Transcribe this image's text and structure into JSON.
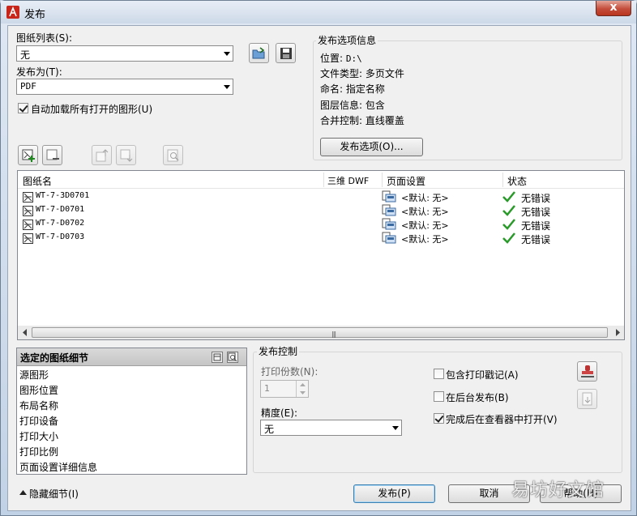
{
  "window": {
    "title": "发布",
    "close_label": "x"
  },
  "sheet_list": {
    "label": "图纸列表(S):",
    "value": "无"
  },
  "publish_to": {
    "label": "发布为(T):",
    "value": "PDF"
  },
  "auto_load": {
    "label": "自动加载所有打开的图形(U)",
    "checked": true
  },
  "publish_info": {
    "title": "发布选项信息",
    "location_label": "位置:",
    "location_value": "D:\\",
    "file_type_label": "文件类型:",
    "file_type_value": "多页文件",
    "naming_label": "命名:",
    "naming_value": "指定名称",
    "layer_label": "图层信息:",
    "layer_value": "包含",
    "merge_label": "合并控制:",
    "merge_value": "直线覆盖",
    "options_button": "发布选项(O)..."
  },
  "sheet_table": {
    "columns": [
      "图纸名",
      "三维 DWF",
      "页面设置",
      "状态"
    ],
    "rows": [
      {
        "name": "WT-7-3D0701",
        "page_setup": "<默认: 无>",
        "status": "无错误"
      },
      {
        "name": "WT-7-D0701",
        "page_setup": "<默认: 无>",
        "status": "无错误"
      },
      {
        "name": "WT-7-D0702",
        "page_setup": "<默认: 无>",
        "status": "无错误"
      },
      {
        "name": "WT-7-D0703",
        "page_setup": "<默认: 无>",
        "status": "无错误"
      }
    ],
    "scroll_grip": "|||"
  },
  "details": {
    "title": "选定的图纸细节",
    "items": [
      "源图形",
      "图形位置",
      "布局名称",
      "打印设备",
      "打印大小",
      "打印比例",
      "页面设置详细信息"
    ]
  },
  "publish_control": {
    "title": "发布控制",
    "copies_label": "打印份数(N):",
    "copies_value": "1",
    "precision_label": "精度(E):",
    "precision_value": "无",
    "include_stamp_label": "包含打印戳记(A)",
    "include_stamp_checked": false,
    "background_label": "在后台发布(B)",
    "background_checked": false,
    "open_viewer_label": "完成后在查看器中打开(V)",
    "open_viewer_checked": true
  },
  "footer": {
    "hide_details": "隐藏细节(I)",
    "publish_button": "发布(P)",
    "cancel_button": "取消",
    "help_button": "帮助(H)"
  },
  "watermark": "易坊好文馆",
  "colors": {
    "title_icon": "#c8261b",
    "check_green": "#2a9a2a",
    "close_red": "#c44d3b"
  }
}
